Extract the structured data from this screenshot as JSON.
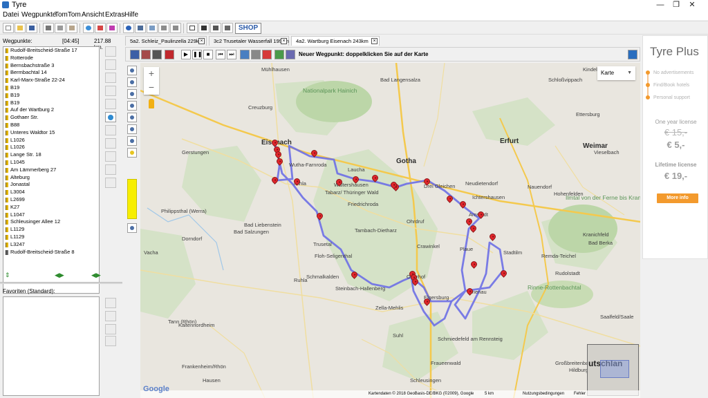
{
  "window": {
    "title": "Tyre",
    "min": "—",
    "max": "❐",
    "close": "✕"
  },
  "menu": [
    "Datei",
    "Wegpunkte",
    "TomTom",
    "Ansicht",
    "Extras",
    "Hilfe"
  ],
  "toolbar": {
    "shop_label": "SHOP"
  },
  "waypoints": {
    "label": "Wegpunkte:",
    "time": "[04:45]",
    "distance": "217.88 km.",
    "items": [
      "Rudolf-Breitscheid-Straße 17",
      "Rotterode",
      "Bernsbachstraße 3",
      "Bermbachtal 14",
      "Karl-Marx-Straße 22-24",
      "B19",
      "B19",
      "B19",
      "Auf der Wartburg 2",
      "Gothaer Str.",
      "B88",
      "Unteres Waldtor 15",
      "L1026",
      "L1026",
      "Lange Str. 18",
      "L1045",
      "Am Lämmerberg 27",
      "Alteburg",
      "Jonastal",
      "L3004",
      "L2699",
      "K27",
      "L1047",
      "Schleusinger Allee 12",
      "L1129",
      "L1129",
      "L3247",
      "Rudolf-Breitscheid-Straße 8"
    ]
  },
  "favorites": {
    "label": "Favoriten (Standard):"
  },
  "tabs": [
    {
      "label": "5a2. Schleiz_Paulinzella 229km"
    },
    {
      "label": "3c2 Trusetaler Wasserfall 199km"
    },
    {
      "label": "4a2. Wartburg Eisenach 243km"
    }
  ],
  "map_toolbar": {
    "hint": "Neuer Wegpunkt: doppelklicken Sie auf der Karte"
  },
  "map": {
    "type_selector": "Karte",
    "zoom_in": "+",
    "zoom_out": "−",
    "google_logo": "Google",
    "attribution": "Kartendaten © 2018 GeoBasis-DE/BKG (©2009), Google",
    "scale": "5 km",
    "terms": "Nutzungsbedingungen",
    "error": "Fehler",
    "overview_label": "utschlan",
    "places": [
      "Nationalpark Hainich",
      "Eisenach",
      "Gotha",
      "Erfurt",
      "Weimar",
      "Bad Langensalza",
      "Mühlhausen",
      "Schloßvippach",
      "Kindelbrück",
      "Creuzburg",
      "Mihla",
      "Laucha",
      "Waltershausen",
      "Friedrichroda",
      "Tabarz/ Thüringer Wald",
      "Ohrdruf",
      "Wutha-Farnroda",
      "Ruhla",
      "Trusetal",
      "Floh-Seligenthal",
      "Schmalkalden",
      "Steinbach-Hallenberg",
      "Oberhof",
      "Zella-Mehlis",
      "Suhl",
      "Ilmenau",
      "Arnstadt",
      "Plaue",
      "Elgersburg",
      "Stadtilm",
      "Rudolstadt",
      "Bad Salzungen",
      "Gerstungen",
      "Bad Liebenstein",
      "Dorndorf",
      "Vacha",
      "Philippsthal (Werra)",
      "Tann (Rhön)",
      "Kaltennordheim",
      "Frankenheim/Rhön",
      "Hausen",
      "Schleusingen",
      "Hildburghausen",
      "Schmiedefeld am Rennsteig",
      "Fraueenwald",
      "Ilmtal von der Ferne bis Kranichfeld",
      "Rinne-Rottenbachtal",
      "Drei Gleichen",
      "Neudietendorf",
      "Hohenfelden",
      "Bad Berka",
      "Remda-Teichel",
      "Saalfeld/Saale",
      "Großbreitenbach",
      "Tambach-Dietharz",
      "Crawinkel",
      "Ichtershausen",
      "Nauendorf",
      "Kranichfeld",
      "Ettersburg",
      "Vieselbach"
    ]
  },
  "ad": {
    "title": "Tyre Plus",
    "features": [
      "No advertisements",
      "Find/Book hotels",
      "Personal support"
    ],
    "yearly_label": "One year license",
    "yearly_old": "€ 15,-",
    "yearly_price": "€ 5,-",
    "lifetime_label": "Lifetime license",
    "lifetime_price": "€ 19,-",
    "more_info": "More info",
    "accent": "#f39a2d"
  },
  "colors": {
    "route": "#6d6fe6",
    "marker": "#e1262b",
    "highlight": "#f7ee00"
  }
}
